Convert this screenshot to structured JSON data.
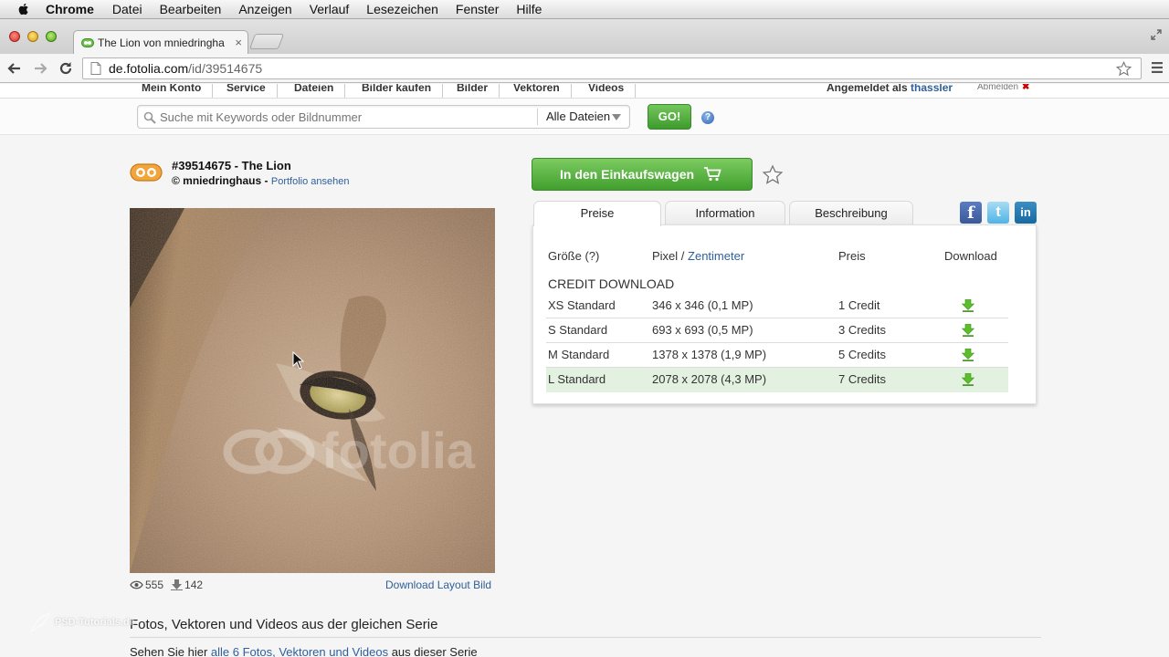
{
  "menubar": {
    "app": "Chrome",
    "items": [
      "Datei",
      "Bearbeiten",
      "Anzeigen",
      "Verlauf",
      "Lesezeichen",
      "Fenster",
      "Hilfe"
    ]
  },
  "browser": {
    "tab_title": "The Lion von mniedringha",
    "tab_close": "×",
    "url_host": "de.fotolia.com",
    "url_path": "/id/39514675"
  },
  "site_nav": {
    "items": [
      "Mein Konto",
      "Service",
      "Dateien",
      "Bilder kaufen",
      "Bilder",
      "Vektoren",
      "Videos"
    ],
    "logged_in_label": "Angemeldet als",
    "logged_in_user": "thassler",
    "logout": "Abmelden"
  },
  "search": {
    "placeholder": "Suche mit Keywords oder Bildnummer",
    "category": "Alle Dateien",
    "go_label": "GO!",
    "help": "?"
  },
  "image": {
    "title": "#39514675 - The Lion",
    "author": "© mniedringhaus",
    "author_sep": " - ",
    "portfolio_link": "Portfolio ansehen",
    "views": "555",
    "downloads": "142",
    "layout_link": "Download Layout Bild"
  },
  "actions": {
    "cart_label": "In den Einkaufswagen"
  },
  "tabs": {
    "items": [
      "Preise",
      "Information",
      "Beschreibung"
    ],
    "active": "Preise"
  },
  "social": {
    "fb": "f",
    "tw": "t",
    "li": "in"
  },
  "pricing": {
    "header_size": "Größe (?)",
    "header_unit_pixel": "Pixel",
    "header_unit_sep": " / ",
    "header_unit_cm": "Zentimeter",
    "header_price": "Preis",
    "header_download": "Download",
    "section_title": "CREDIT DOWNLOAD",
    "rows": [
      {
        "size": "XS Standard",
        "dims": "346 x 346 (0,1 MP)",
        "price": "1 Credit"
      },
      {
        "size": "S Standard",
        "dims": "693 x 693 (0,5 MP)",
        "price": "3 Credits"
      },
      {
        "size": "M Standard",
        "dims": "1378 x 1378 (1,9 MP)",
        "price": "5 Credits"
      },
      {
        "size": "L Standard",
        "dims": "2078 x 2078 (4,3 MP)",
        "price": "7 Credits"
      }
    ],
    "highlight_color": "#e3f1e0"
  },
  "series": {
    "title": "Fotos, Vektoren und Videos aus der gleichen Serie",
    "sub_pre": "Sehen Sie hier ",
    "sub_link": "alle 6 Fotos, Vektoren und Videos",
    "sub_post": " aus dieser Serie"
  },
  "watermark": {
    "text": "PSD-Tutorials.de"
  },
  "colors": {
    "accent_green": "#4ea631",
    "link_blue": "#2f5f9a"
  }
}
